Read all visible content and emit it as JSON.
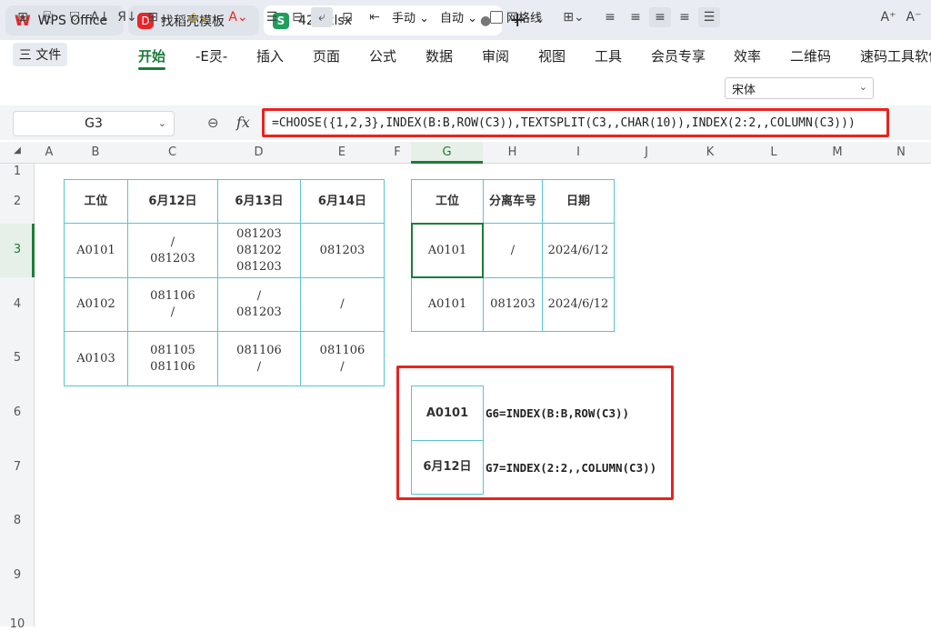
{
  "tabs": [
    {
      "label": "WPS Office",
      "icon": "wps-logo-icon",
      "logo_text": "W"
    },
    {
      "label": "找稻壳模板",
      "icon": "docer-icon",
      "logo_text": "D"
    },
    {
      "label": "425.xlsx",
      "icon": "spreadsheet-icon",
      "logo_text": "S",
      "active": true
    }
  ],
  "new_tab_label": "+",
  "file_menu": "三 文件",
  "menus": [
    "开始",
    "-E灵-",
    "插入",
    "页面",
    "公式",
    "数据",
    "审阅",
    "视图",
    "工具",
    "会员专享",
    "效率",
    "二维码",
    "速码工具软件"
  ],
  "active_menu": "开始",
  "toolbar": {
    "manual_label": "手动",
    "auto_label": "自动",
    "gridlines_label": "网格线",
    "font_name": "宋体",
    "font_grow": "A⁺",
    "font_shrink": "A⁻"
  },
  "name_box": "G3",
  "fx_label": "fx",
  "formula": "=CHOOSE({1,2,3},INDEX(B:B,ROW(C3)),TEXTSPLIT(C3,,CHAR(10)),INDEX(2:2,,COLUMN(C3)))",
  "columns": [
    "A",
    "B",
    "C",
    "D",
    "E",
    "F",
    "G",
    "H",
    "I",
    "J",
    "K",
    "L",
    "M",
    "N"
  ],
  "selected_column": "G",
  "rows": [
    "1",
    "2",
    "3",
    "4",
    "5",
    "6",
    "7",
    "8",
    "9",
    "10"
  ],
  "selected_row": "3",
  "table1": {
    "headers": [
      "工位",
      "6月12日",
      "6月13日",
      "6月14日"
    ],
    "rows": [
      [
        "A0101",
        "/\n081203",
        "081203\n081202\n081203",
        "081203"
      ],
      [
        "A0102",
        "081106\n/",
        "/\n081203",
        "/"
      ],
      [
        "A0103",
        "081105\n081106",
        "081106\n/",
        "081106\n/"
      ]
    ]
  },
  "table2": {
    "headers": [
      "工位",
      "分离车号",
      "日期"
    ],
    "rows": [
      [
        "A0101",
        "/",
        "2024/6/12"
      ],
      [
        "A0101",
        "081203",
        "2024/6/12"
      ]
    ]
  },
  "example": {
    "g6_value": "A0101",
    "g6_formula": "G6=INDEX(B:B,ROW(C3))",
    "g7_value": "6月12日",
    "g7_formula": "G7=INDEX(2:2,,COLUMN(C3))"
  },
  "colors": {
    "accent_green": "#1c7c3a",
    "highlight_red": "#e8231f",
    "table_border": "#5ac3d6"
  }
}
